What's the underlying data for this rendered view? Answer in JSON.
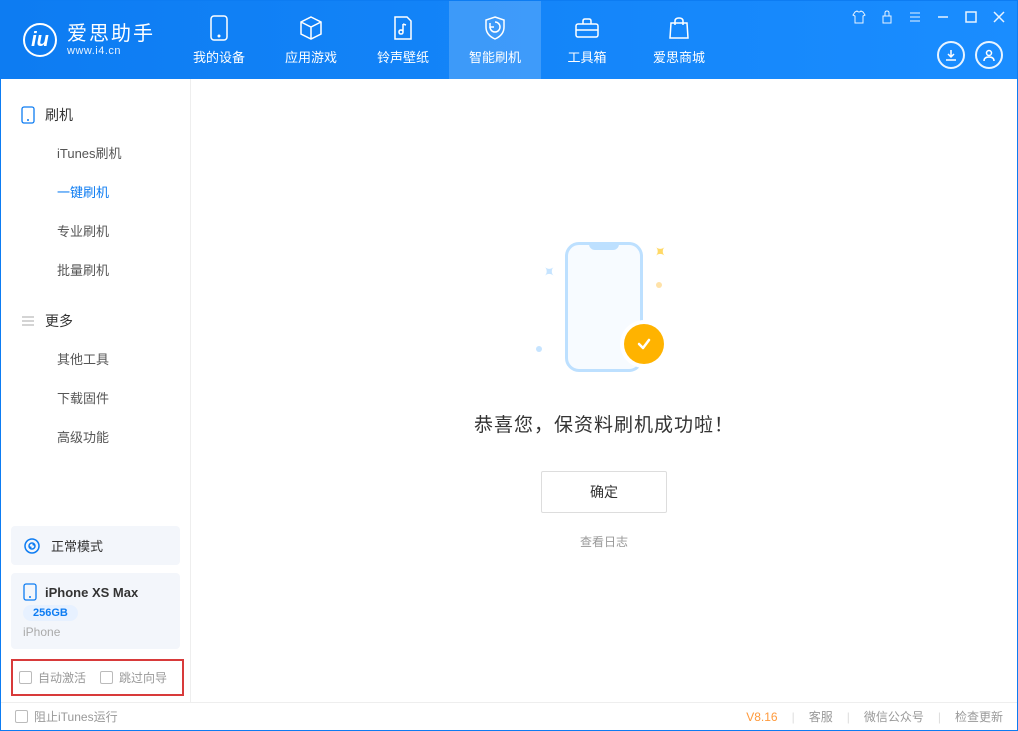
{
  "app": {
    "title": "爱思助手",
    "subtitle": "www.i4.cn"
  },
  "nav": {
    "tabs": [
      {
        "label": "我的设备"
      },
      {
        "label": "应用游戏"
      },
      {
        "label": "铃声壁纸"
      },
      {
        "label": "智能刷机"
      },
      {
        "label": "工具箱"
      },
      {
        "label": "爱思商城"
      }
    ]
  },
  "sidebar": {
    "group_flash": "刷机",
    "items_flash": [
      {
        "label": "iTunes刷机"
      },
      {
        "label": "一键刷机"
      },
      {
        "label": "专业刷机"
      },
      {
        "label": "批量刷机"
      }
    ],
    "group_more": "更多",
    "items_more": [
      {
        "label": "其他工具"
      },
      {
        "label": "下载固件"
      },
      {
        "label": "高级功能"
      }
    ],
    "mode_label": "正常模式",
    "device_name": "iPhone XS Max",
    "capacity": "256GB",
    "device_type": "iPhone",
    "auto_activate": "自动激活",
    "skip_guide": "跳过向导"
  },
  "main": {
    "success_message": "恭喜您，保资料刷机成功啦！",
    "confirm": "确定",
    "view_log": "查看日志"
  },
  "footer": {
    "block_itunes": "阻止iTunes运行",
    "version": "V8.16",
    "customer_service": "客服",
    "wechat": "微信公众号",
    "check_update": "检查更新"
  }
}
